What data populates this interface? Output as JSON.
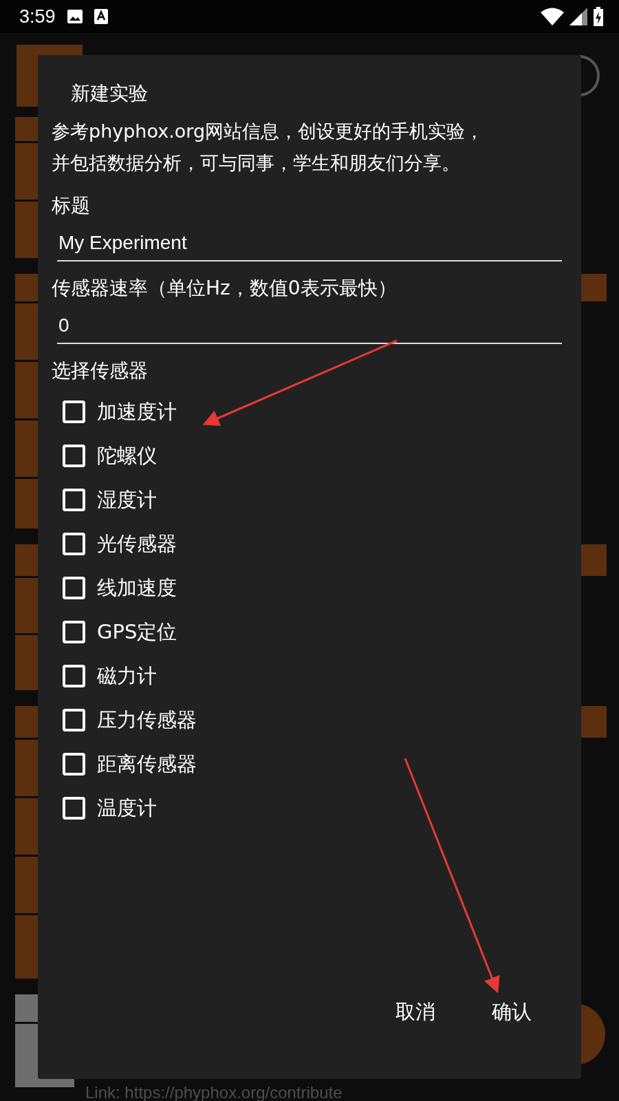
{
  "status_bar": {
    "time": "3:59"
  },
  "background": {
    "link": "Link: https://phyphox.org/contribute"
  },
  "dialog": {
    "title": "新建实验",
    "description_lines": [
      "参考phyphox.org网站信息，创设更好的手机实验，",
      "并包括数据分析，可与同事，学生和朋友们分享。"
    ],
    "fields": [
      {
        "label": "标题",
        "value": "My Experiment"
      },
      {
        "label": "传感器速率（单位Hz，数值0表示最快）",
        "value": "0"
      }
    ],
    "sensors_label": "选择传感器",
    "sensors": [
      {
        "label": "加速度计",
        "checked": false
      },
      {
        "label": "陀螺仪",
        "checked": false
      },
      {
        "label": "湿度计",
        "checked": false
      },
      {
        "label": "光传感器",
        "checked": false
      },
      {
        "label": "线加速度",
        "checked": false
      },
      {
        "label": "GPS定位",
        "checked": false
      },
      {
        "label": "磁力计",
        "checked": false
      },
      {
        "label": "压力传感器",
        "checked": false
      },
      {
        "label": "距离传感器",
        "checked": false
      },
      {
        "label": "温度计",
        "checked": false
      }
    ],
    "buttons": [
      "取消",
      "确认"
    ]
  }
}
